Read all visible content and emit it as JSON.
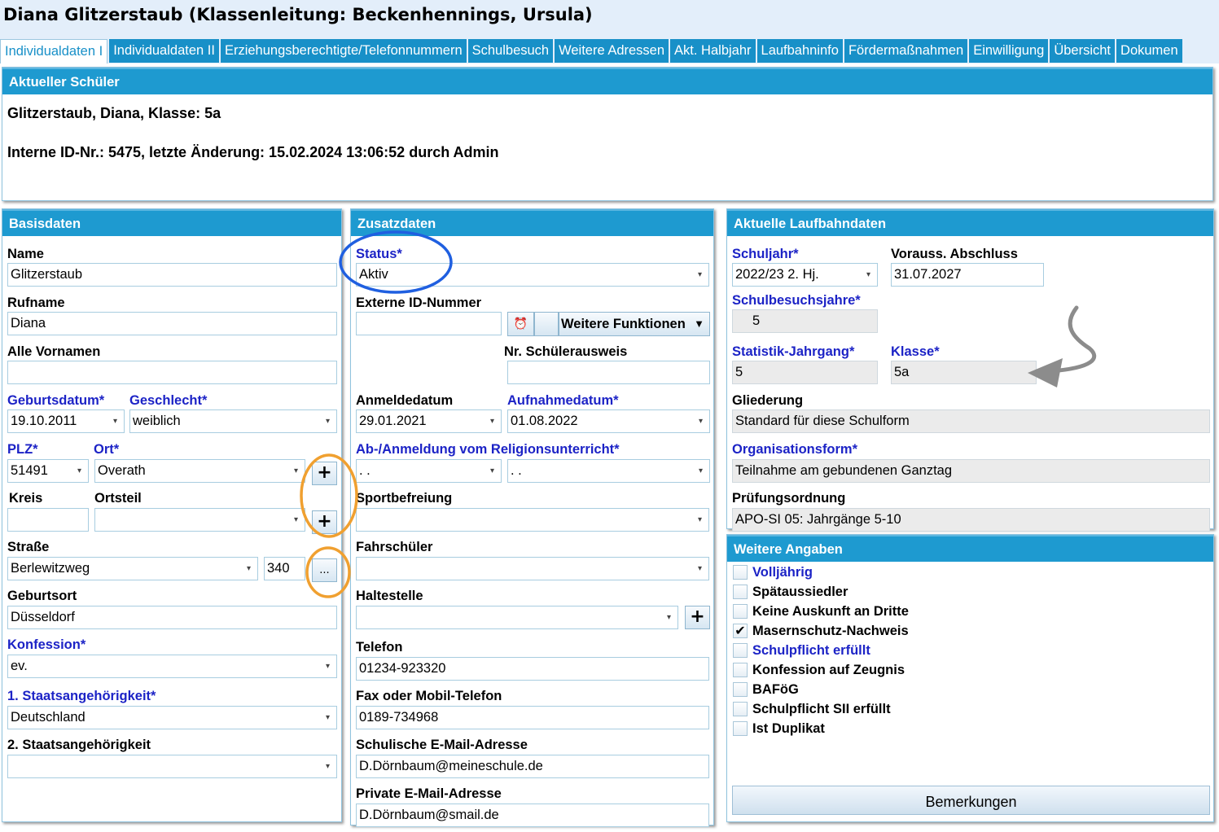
{
  "window": {
    "title": "Diana Glitzerstaub (Klassenleitung: Beckenhennings, Ursula)"
  },
  "tabs": [
    "Individualdaten I",
    "Individualdaten II",
    "Erziehungsberechtigte/Telefonnummern",
    "Schulbesuch",
    "Weitere Adressen",
    "Akt. Halbjahr",
    "Laufbahninfo",
    "Fördermaßnahmen",
    "Einwilligung",
    "Übersicht",
    "Dokumen"
  ],
  "current": {
    "header": "Aktueller Schüler",
    "line1": "Glitzerstaub, Diana, Klasse: 5a",
    "line2": "Interne ID-Nr.: 5475, letzte Änderung: 15.02.2024 13:06:52 durch Admin"
  },
  "basis": {
    "header": "Basisdaten",
    "name_label": "Name",
    "name": "Glitzerstaub",
    "rufname_label": "Rufname",
    "rufname": "Diana",
    "vornamen_label": "Alle Vornamen",
    "vornamen": "",
    "geburtsdatum_label": "Geburtsdatum*",
    "geburtsdatum": "19.10.2011",
    "geschlecht_label": "Geschlecht*",
    "geschlecht": "weiblich",
    "plz_label": "PLZ*",
    "plz": "51491",
    "ort_label": "Ort*",
    "ort": "Overath",
    "kreis_label": "Kreis",
    "kreis": "",
    "ortsteil_label": "Ortsteil",
    "ortsteil": "",
    "strasse_label": "Straße",
    "strasse": "Berlewitzweg",
    "hausnr": "340",
    "geburtsort_label": "Geburtsort",
    "geburtsort": "Düsseldorf",
    "konfession_label": "Konfession*",
    "konfession": "ev.",
    "staat1_label": "1. Staatsangehörigkeit*",
    "staat1": "Deutschland",
    "staat2_label": "2. Staatsangehörigkeit",
    "staat2": "",
    "plus": "+",
    "dots": "..."
  },
  "zusatz": {
    "header": "Zusatzdaten",
    "status_label": "Status*",
    "status": "Aktiv",
    "extid_label": "Externe ID-Nummer",
    "extid": "",
    "weitere_btn": "Weitere Funktionen",
    "ausweis_label": "Nr. Schülerausweis",
    "ausweis": "",
    "anmelde_label": "Anmeldedatum",
    "anmelde": "29.01.2021",
    "aufnahme_label": "Aufnahmedatum*",
    "aufnahme": "01.08.2022",
    "religion_label": "Ab-/Anmeldung vom Religionsunterricht*",
    "religion_ab": " .  .",
    "religion_an": " .  .",
    "sport_label": "Sportbefreiung",
    "sport": "",
    "fahr_label": "Fahrschüler",
    "fahr": "",
    "halte_label": "Haltestelle",
    "halte": "",
    "telefon_label": "Telefon",
    "telefon": "01234-923320",
    "fax_label": "Fax oder Mobil-Telefon",
    "fax": "0189-734968",
    "smail_label": "Schulische E-Mail-Adresse",
    "smail": "D.Dörnbaum@meineschule.de",
    "pmail_label": "Private E-Mail-Adresse",
    "pmail": "D.Dörnbaum@smail.de"
  },
  "laufbahn": {
    "header": "Aktuelle Laufbahndaten",
    "schuljahr_label": "Schuljahr*",
    "schuljahr": "2022/23 2. Hj.",
    "abschluss_label": "Vorauss. Abschluss",
    "abschluss": "31.07.2027",
    "sbj_label": "Schulbesuchsjahre*",
    "sbj": "5",
    "stat_label": "Statistik-Jahrgang*",
    "stat": "5",
    "klasse_label": "Klasse*",
    "klasse": "5a",
    "gliederung_label": "Gliederung",
    "gliederung": "Standard für diese Schulform",
    "org_label": "Organisationsform*",
    "org": "Teilnahme am gebundenen Ganztag",
    "pruef_label": "Prüfungsordnung",
    "pruef": "APO-SI 05: Jahrgänge 5-10"
  },
  "weitere": {
    "header": "Weitere Angaben",
    "items": [
      {
        "label": "Volljährig",
        "checked": false
      },
      {
        "label": "Spätaussiedler",
        "checked": false
      },
      {
        "label": "Keine Auskunft an Dritte",
        "checked": false
      },
      {
        "label": "Masernschutz-Nachweis",
        "checked": true
      },
      {
        "label": "Schulpflicht erfüllt",
        "checked": false
      },
      {
        "label": "Konfession auf Zeugnis",
        "checked": false
      },
      {
        "label": "BAFöG",
        "checked": false
      },
      {
        "label": "Schulpflicht SII erfüllt",
        "checked": false
      },
      {
        "label": "Ist Duplikat",
        "checked": false
      }
    ],
    "bemerkungen": "Bemerkungen"
  },
  "colors": {
    "accent": "#1e9ad0",
    "required": "#1c23c6",
    "highlight_blue": "#1f5fe0",
    "highlight_orange": "#f0a030"
  }
}
